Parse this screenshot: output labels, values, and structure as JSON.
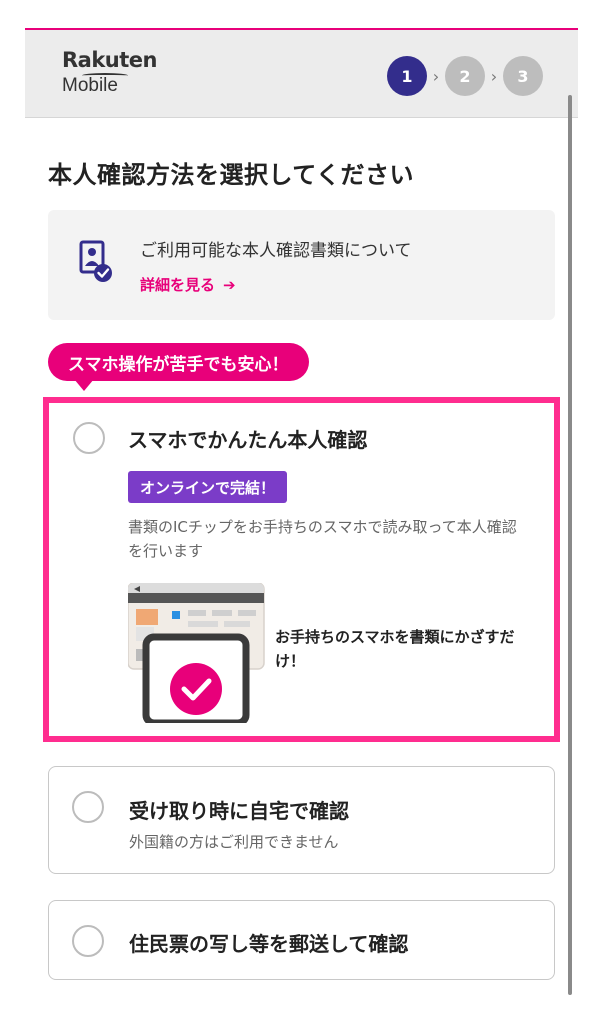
{
  "header": {
    "logo_line1": "Rakuten",
    "logo_line2": "Mobile",
    "steps": [
      "1",
      "2",
      "3"
    ],
    "active_step": 1
  },
  "page": {
    "title": "本人確認方法を選択してください"
  },
  "info": {
    "text": "ご利用可能な本人確認書類について",
    "link": "詳細を見る",
    "icon": "id-document-check-icon"
  },
  "bubble": "スマホ操作が苦手でも安心！",
  "options": [
    {
      "title": "スマホでかんたん本人確認",
      "badge": "オンラインで完結！",
      "description": "書類のICチップをお手持ちのスマホで読み取って本人確認を行います",
      "illustration_caption": "お手持ちのスマホを書類にかざすだけ！",
      "highlighted": true
    },
    {
      "title": "受け取り時に自宅で確認",
      "note": "外国籍の方はご利用できません"
    },
    {
      "title": "住民票の写し等を郵送して確認"
    }
  ],
  "colors": {
    "brand_pink": "#e8007a",
    "highlight_pink": "#ff2d8f",
    "step_active": "#332d8c",
    "badge_purple": "#7b3cc8"
  }
}
